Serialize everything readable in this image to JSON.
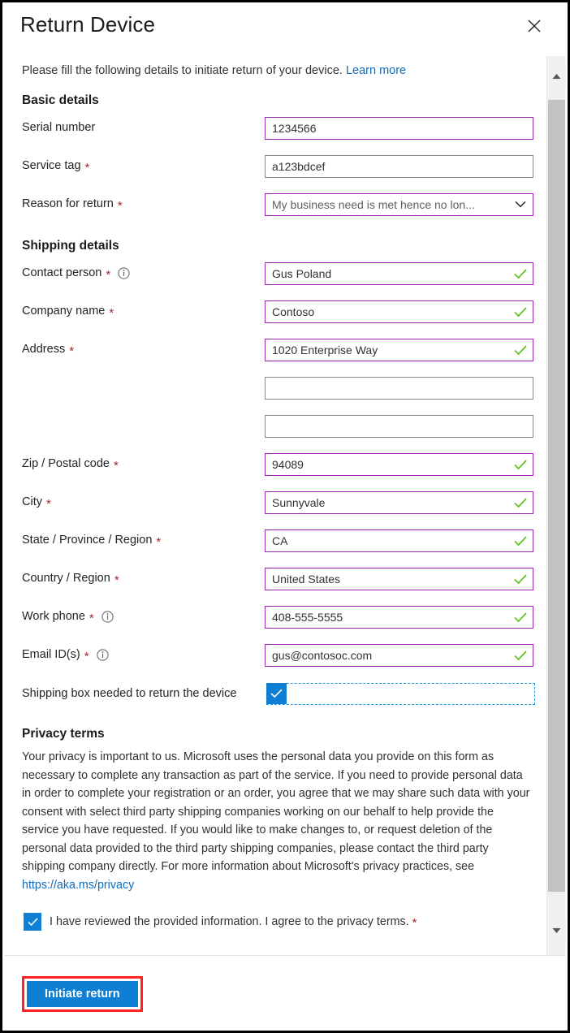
{
  "dialog": {
    "title": "Return Device",
    "close_icon": "close-icon",
    "intro_text": "Please fill the following details to initiate return of your device.",
    "intro_link": "Learn more"
  },
  "sections": {
    "basic": {
      "heading": "Basic details",
      "fields": [
        {
          "label": "Serial number",
          "required": false,
          "info": false,
          "value": "1234566",
          "state": "valid",
          "check": false,
          "type": "text"
        },
        {
          "label": "Service tag",
          "required": true,
          "info": false,
          "value": "a123bdcef",
          "state": "neutral",
          "check": false,
          "type": "text"
        },
        {
          "label": "Reason for return",
          "required": true,
          "info": false,
          "value": "My business need is met hence no lon...",
          "state": "valid",
          "check": false,
          "type": "select"
        }
      ]
    },
    "shipping": {
      "heading": "Shipping details",
      "fields": [
        {
          "label": "Contact person",
          "required": true,
          "info": true,
          "value": "Gus Poland",
          "state": "valid",
          "check": true,
          "type": "text"
        },
        {
          "label": "Company name",
          "required": true,
          "info": false,
          "value": "Contoso",
          "state": "valid",
          "check": true,
          "type": "text"
        },
        {
          "label": "Address",
          "required": true,
          "info": false,
          "value": "1020 Enterprise Way",
          "state": "valid",
          "check": true,
          "type": "text"
        },
        {
          "label": "",
          "required": false,
          "info": false,
          "value": "",
          "state": "neutral",
          "check": false,
          "type": "text"
        },
        {
          "label": "",
          "required": false,
          "info": false,
          "value": "",
          "state": "neutral",
          "check": false,
          "type": "text"
        },
        {
          "label": "Zip / Postal code",
          "required": true,
          "info": false,
          "value": "94089",
          "state": "valid",
          "check": true,
          "type": "text"
        },
        {
          "label": "City",
          "required": true,
          "info": false,
          "value": "Sunnyvale",
          "state": "valid",
          "check": true,
          "type": "text"
        },
        {
          "label": "State / Province / Region",
          "required": true,
          "info": false,
          "value": "CA",
          "state": "valid",
          "check": true,
          "type": "text"
        },
        {
          "label": "Country / Region",
          "required": true,
          "info": false,
          "value": "United States",
          "state": "valid",
          "check": true,
          "type": "text"
        },
        {
          "label": "Work phone",
          "required": true,
          "info": true,
          "value": "408-555-5555",
          "state": "valid",
          "check": true,
          "type": "text"
        },
        {
          "label": "Email ID(s)",
          "required": true,
          "info": true,
          "value": "gus@contosoc.com",
          "state": "valid",
          "check": true,
          "type": "text"
        }
      ],
      "shipping_box": {
        "label": "Shipping box needed to return the device",
        "checked": true
      }
    },
    "privacy": {
      "heading": "Privacy terms",
      "body": "Your privacy is important to us. Microsoft uses the personal data you provide on this form as necessary to complete any transaction as part of the service. If you need to provide personal data in order to complete your registration or an order, you agree that we may share such data with your consent with select third party shipping companies working on our behalf to help provide the service you have requested. If you would like to make changes to, or request deletion of the personal data provided to the third party shipping companies, please contact the third party shipping company directly. For more information about Microsoft's privacy practices, see ",
      "link_text": "https://aka.ms/privacy",
      "agreement_text": "I have reviewed the provided information. I agree to the privacy terms.",
      "agreement_required": "*",
      "agreement_checked": true
    }
  },
  "footer": {
    "primary_label": "Initiate return"
  },
  "scrollbar": {
    "up_icon": "caret-up-icon",
    "down_icon": "caret-down-icon"
  },
  "colors": {
    "accent_blue": "#0f7fd4",
    "valid_border": "#9b26b6",
    "neutral_border": "#8a8886",
    "check_green": "#5fc11e",
    "required_red": "#a4262c",
    "link_blue": "#0f6cbd",
    "annotation_red": "#ff2020"
  }
}
